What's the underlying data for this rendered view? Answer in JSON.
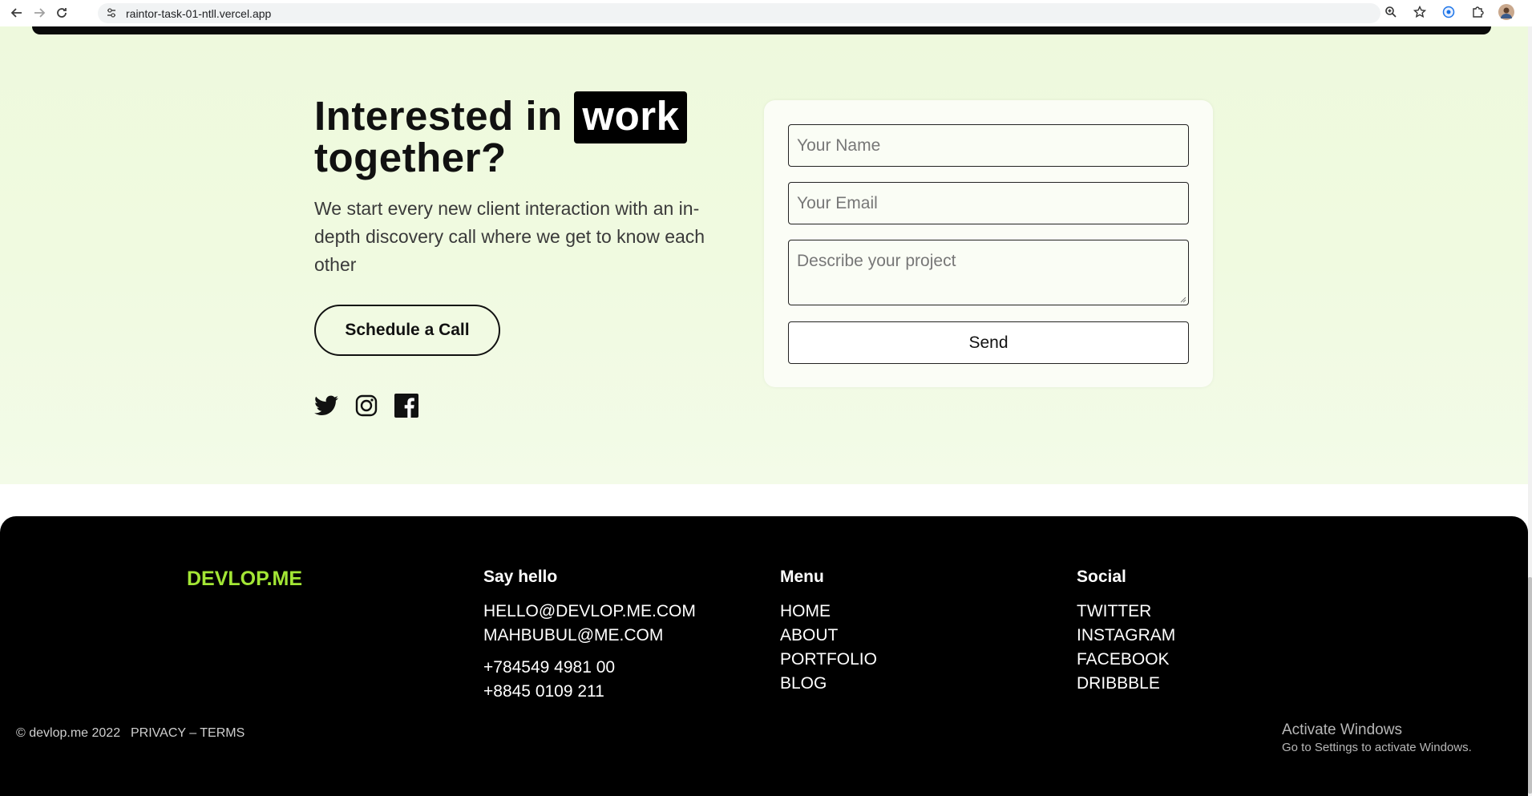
{
  "browser": {
    "url": "raintor-task-01-ntll.vercel.app"
  },
  "hero": {
    "headline_part1": "Interested in ",
    "headline_highlight": "work",
    "headline_part2": "together?",
    "subtext": "We start every new client interaction with an in-depth discovery call where we get to know each other",
    "schedule_label": "Schedule a Call"
  },
  "form": {
    "name_placeholder": "Your Name",
    "email_placeholder": "Your Email",
    "project_placeholder": "Describe your project",
    "send_label": "Send"
  },
  "footer": {
    "brand": "DEVLOP.ME",
    "say_hello": {
      "title": "Say hello",
      "emails": [
        "HELLO@DEVLOP.ME.COM",
        "MAHBUBUL@ME.COM"
      ],
      "phones": [
        "+784549 4981 00",
        "+8845 0109 211"
      ]
    },
    "menu": {
      "title": "Menu",
      "items": [
        "HOME",
        "ABOUT",
        "PORTFOLIO",
        "BLOG"
      ]
    },
    "social": {
      "title": "Social",
      "items": [
        "TWITTER",
        "INSTAGRAM",
        "FACEBOOK",
        "DRIBBBLE"
      ]
    },
    "copyright": "© devlop.me 2022",
    "legal": "PRIVACY – TERMS"
  },
  "windows_watermark": {
    "title": "Activate Windows",
    "subtitle": "Go to Settings to activate Windows."
  },
  "colors": {
    "brand_accent": "#a3e635",
    "footer_bg": "#000000",
    "hero_bg": "#eef9dd"
  }
}
